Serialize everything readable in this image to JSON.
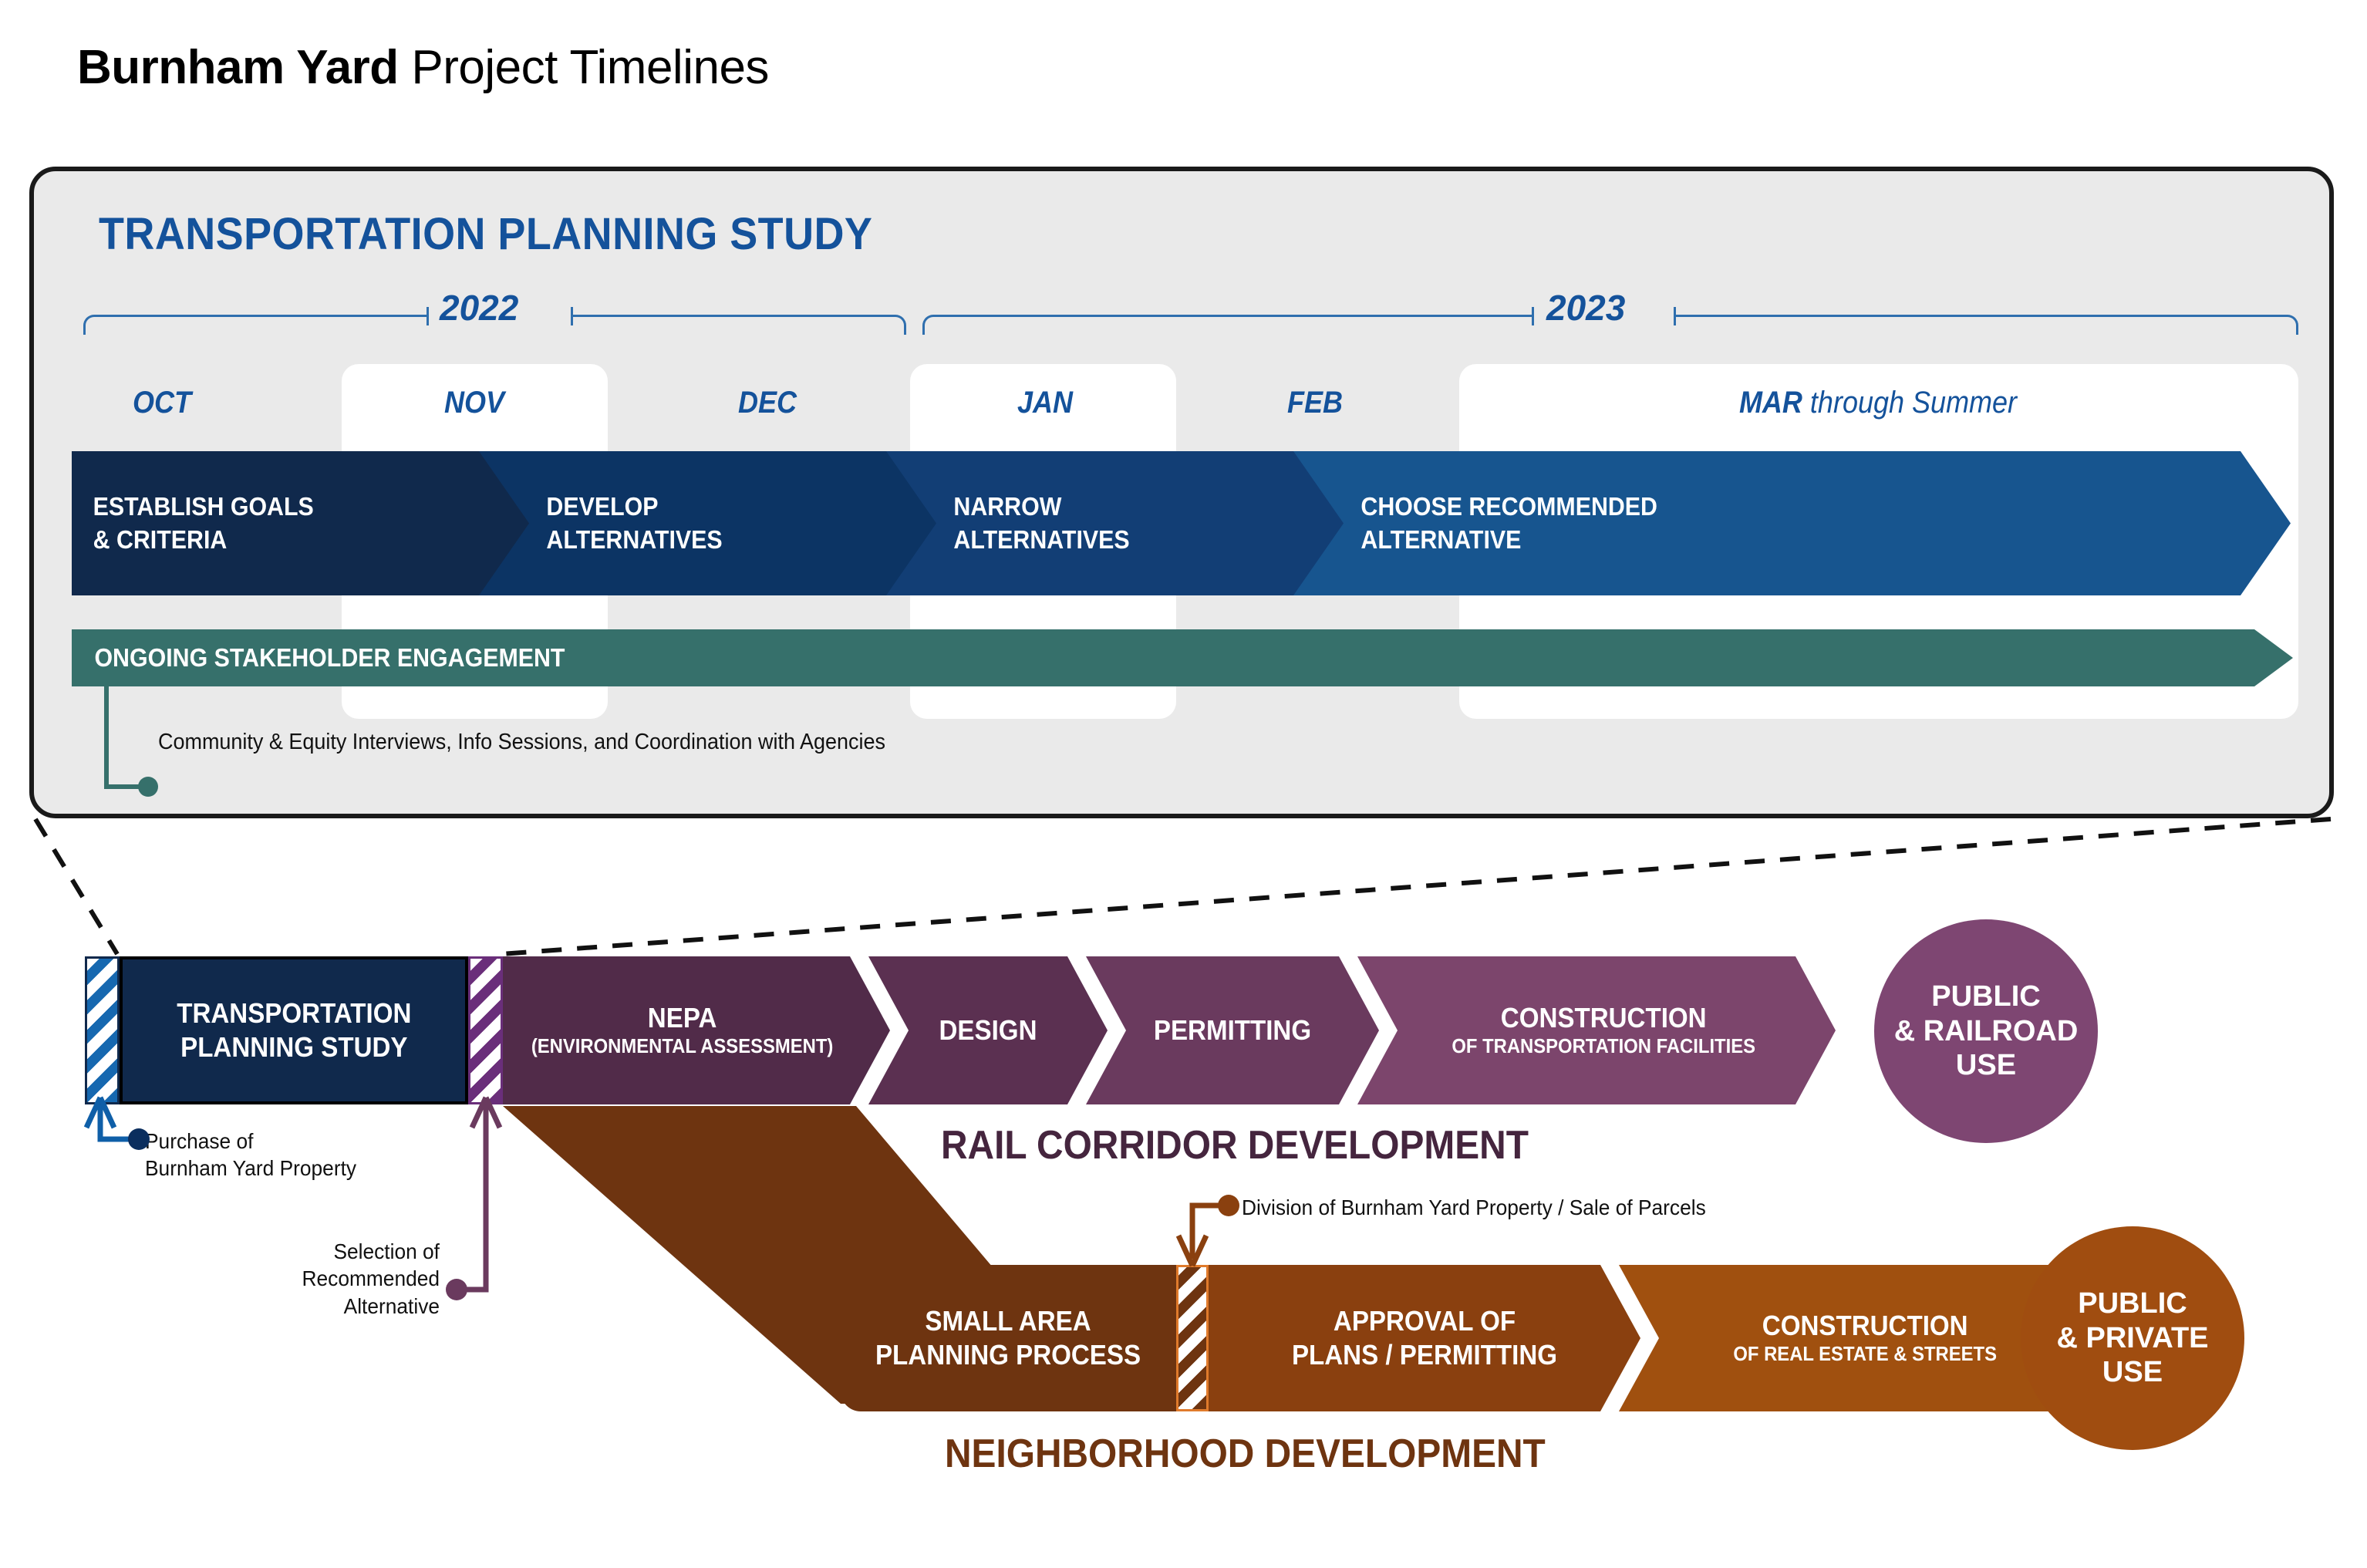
{
  "title": {
    "bold": "Burnham Yard",
    "light": " Project Timelines"
  },
  "panel": {
    "heading": "TRANSPORTATION PLANNING STUDY",
    "years": [
      {
        "label": "2022"
      },
      {
        "label": "2023"
      }
    ],
    "months": [
      {
        "label": "OCT",
        "thin": ""
      },
      {
        "label": "NOV",
        "thin": ""
      },
      {
        "label": "DEC",
        "thin": ""
      },
      {
        "label": "JAN",
        "thin": ""
      },
      {
        "label": "FEB",
        "thin": ""
      },
      {
        "label": "MAR",
        "thin": " through Summer"
      }
    ],
    "phases": [
      {
        "label": "ESTABLISH GOALS\n& CRITERIA",
        "color": "#10294C"
      },
      {
        "label": "DEVELOP\nALTERNATIVES",
        "color": "#0C3464"
      },
      {
        "label": "NARROW\nALTERNATIVES",
        "color": "#123E75"
      },
      {
        "label": "CHOOSE RECOMMENDED\nALTERNATIVE",
        "color": "#17558F"
      }
    ],
    "engagement": {
      "label": "ONGOING STAKEHOLDER ENGAGEMENT",
      "color": "#36706B"
    },
    "engagement_note": "Community & Equity Interviews, Info Sessions, and Coordination with Agencies"
  },
  "rail": {
    "section_title": "RAIL CORRIDOR DEVELOPMENT",
    "section_color": "#45253E",
    "study_block": {
      "label": "TRANSPORTATION\nPLANNING STUDY",
      "color": "#10294C"
    },
    "steps": [
      {
        "label": "NEPA",
        "sub": "(ENVIRONMENTAL ASSESSMENT)",
        "color": "#512B49"
      },
      {
        "label": "DESIGN",
        "sub": "",
        "color": "#5B3051"
      },
      {
        "label": "PERMITTING",
        "sub": "",
        "color": "#6A3A5E"
      },
      {
        "label": "CONSTRUCTION",
        "sub": "OF TRANSPORTATION FACILITIES",
        "color": "#7C456C"
      }
    ],
    "end_circle": {
      "label": "PUBLIC\n& RAILROAD\nUSE",
      "color": "#7E4672"
    }
  },
  "neighborhood": {
    "section_title": "NEIGHBORHOOD DEVELOPMENT",
    "section_color": "#6E3410",
    "steps": [
      {
        "label": "SMALL AREA\nPLANNING PROCESS",
        "sub": "",
        "color": "#6E3410"
      },
      {
        "label": "APPROVAL OF\nPLANS / PERMITTING",
        "sub": "",
        "color": "#8A400F"
      },
      {
        "label": "CONSTRUCTION",
        "sub": "OF REAL ESTATE & STREETS",
        "color": "#A0500F"
      }
    ],
    "end_circle": {
      "label": "PUBLIC\n& PRIVATE\nUSE",
      "color": "#A04D10"
    }
  },
  "annotations": [
    {
      "text": "Purchase of\nBurnham Yard Property",
      "color": "#0F5FA8"
    },
    {
      "text": "Selection of\nRecommended\nAlternative",
      "color": "#6A3A5E"
    },
    {
      "text": "Division of Burnham Yard Property / Sale of Parcels",
      "color": "#8A400F"
    }
  ],
  "colors": {
    "panel_bg": "#eaeaea",
    "panel_border": "#1a1a1a",
    "blue_text": "#14529B",
    "bracket": "#2f6fae"
  }
}
